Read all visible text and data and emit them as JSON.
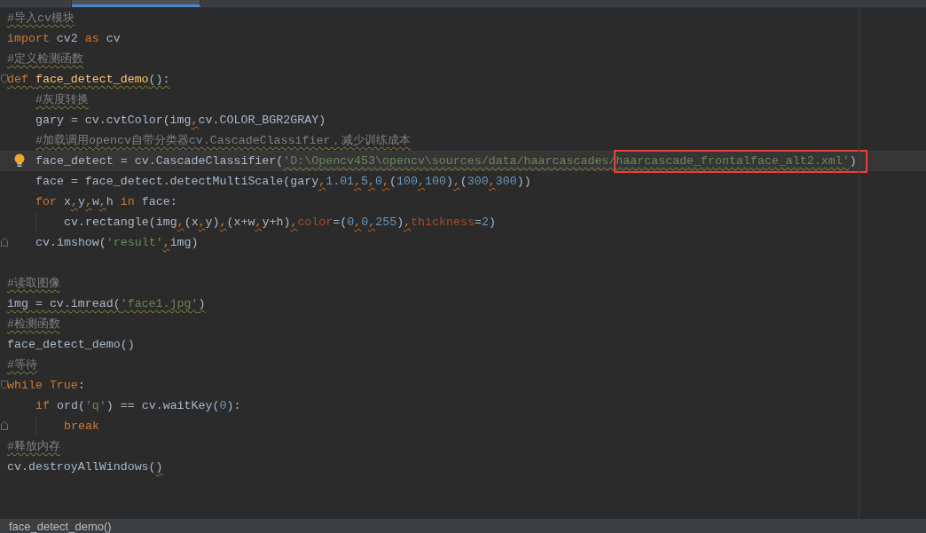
{
  "tabs": [
    {
      "selected": false
    },
    {
      "selected": true
    }
  ],
  "lines": [
    {
      "kind": "code",
      "current": false,
      "tokens": [
        {
          "kind": "comment",
          "text": "#导入cv模块",
          "squiggle": true
        }
      ]
    },
    {
      "kind": "code",
      "current": false,
      "tokens": [
        {
          "kind": "keyword",
          "text": "import",
          "squiggle": false
        },
        {
          "kind": "plain",
          "text": " cv2 ",
          "squiggle": false
        },
        {
          "kind": "keyword",
          "text": "as",
          "squiggle": false
        },
        {
          "kind": "plain",
          "text": " cv",
          "squiggle": false
        }
      ]
    },
    {
      "kind": "code",
      "current": false,
      "tokens": [
        {
          "kind": "comment",
          "text": "#定义检测函数",
          "squiggle": true
        }
      ]
    },
    {
      "kind": "code",
      "current": false,
      "fold": {
        "kind": "start"
      },
      "tokens": [
        {
          "kind": "keyword",
          "text": "def ",
          "squiggle": true
        },
        {
          "kind": "function",
          "text": "face_detect_demo",
          "squiggle": true
        },
        {
          "kind": "plain",
          "text": "():",
          "squiggle": true
        }
      ],
      "children": [
        {
          "kind": "code",
          "current": false,
          "tokens": [
            {
              "kind": "comment",
              "text": "#灰度转换",
              "squiggle": true
            }
          ]
        },
        {
          "kind": "code",
          "current": false,
          "tokens": [
            {
              "kind": "plain",
              "text": "gary = cv.cvtColor(img",
              "squiggle": false
            },
            {
              "kind": "comma",
              "text": ",",
              "squiggle": true
            },
            {
              "kind": "plain",
              "text": "cv.COLOR_BGR2GRAY)",
              "squiggle": false
            }
          ]
        },
        {
          "kind": "code",
          "current": false,
          "tokens": [
            {
              "kind": "comment",
              "text": "#加载调用opencv自带分类器cv.CascadeClassifier，减少训练成本",
              "squiggle": true
            }
          ]
        },
        {
          "kind": "code",
          "current": true,
          "marker": {
            "kind": "bulb"
          },
          "tokens": [
            {
              "kind": "plain",
              "text": "face_detect = cv.CascadeClassifier(",
              "squiggle": false
            },
            {
              "kind": "string",
              "text": "'D:\\Opencv453\\opencv\\sources/data/haarcascades/",
              "squiggle": true
            }
          ],
          "annotated_tokens": [
            {
              "kind": "string",
              "text": "haarcascade_frontalface_alt2.xml'",
              "squiggle": true
            },
            {
              "kind": "plain",
              "text": ")",
              "squiggle": false
            }
          ]
        },
        {
          "kind": "code",
          "current": false,
          "tokens": [
            {
              "kind": "plain",
              "text": "face = face_detect.detectMultiScale(gary",
              "squiggle": false
            },
            {
              "kind": "comma",
              "text": ",",
              "squiggle": true
            },
            {
              "kind": "number",
              "text": "1.01",
              "squiggle": false
            },
            {
              "kind": "comma",
              "text": ",",
              "squiggle": true
            },
            {
              "kind": "number",
              "text": "5",
              "squiggle": false
            },
            {
              "kind": "comma",
              "text": ",",
              "squiggle": true
            },
            {
              "kind": "number",
              "text": "0",
              "squiggle": false
            },
            {
              "kind": "comma",
              "text": ",",
              "squiggle": true
            },
            {
              "kind": "plain",
              "text": "(",
              "squiggle": false
            },
            {
              "kind": "number",
              "text": "100",
              "squiggle": false
            },
            {
              "kind": "comma",
              "text": ",",
              "squiggle": true
            },
            {
              "kind": "number",
              "text": "100",
              "squiggle": false
            },
            {
              "kind": "plain",
              "text": ")",
              "squiggle": false
            },
            {
              "kind": "comma",
              "text": ",",
              "squiggle": true
            },
            {
              "kind": "plain",
              "text": "(",
              "squiggle": false
            },
            {
              "kind": "number",
              "text": "300",
              "squiggle": false
            },
            {
              "kind": "comma",
              "text": ",",
              "squiggle": true
            },
            {
              "kind": "number",
              "text": "300",
              "squiggle": false
            },
            {
              "kind": "plain",
              "text": "))",
              "squiggle": false
            }
          ]
        },
        {
          "kind": "code",
          "current": false,
          "tokens": [
            {
              "kind": "keyword",
              "text": "for",
              "squiggle": false
            },
            {
              "kind": "plain",
              "text": " x",
              "squiggle": false
            },
            {
              "kind": "comma",
              "text": ",",
              "squiggle": true
            },
            {
              "kind": "plain",
              "text": "y",
              "squiggle": false
            },
            {
              "kind": "comma",
              "text": ",",
              "squiggle": true
            },
            {
              "kind": "plain",
              "text": "w",
              "squiggle": false
            },
            {
              "kind": "comma",
              "text": ",",
              "squiggle": true
            },
            {
              "kind": "plain",
              "text": "h ",
              "squiggle": false
            },
            {
              "kind": "keyword",
              "text": "in",
              "squiggle": false
            },
            {
              "kind": "plain",
              "text": " face:",
              "squiggle": false
            }
          ],
          "children": [
            {
              "kind": "code",
              "current": false,
              "tokens": [
                {
                  "kind": "plain",
                  "text": "cv.rectangle(img",
                  "squiggle": false
                },
                {
                  "kind": "comma",
                  "text": ",",
                  "squiggle": true
                },
                {
                  "kind": "plain",
                  "text": "(x",
                  "squiggle": false
                },
                {
                  "kind": "comma",
                  "text": ",",
                  "squiggle": true
                },
                {
                  "kind": "plain",
                  "text": "y)",
                  "squiggle": false
                },
                {
                  "kind": "comma",
                  "text": ",",
                  "squiggle": true
                },
                {
                  "kind": "plain",
                  "text": "(x+w",
                  "squiggle": false
                },
                {
                  "kind": "comma",
                  "text": ",",
                  "squiggle": true
                },
                {
                  "kind": "plain",
                  "text": "y+h)",
                  "squiggle": false
                },
                {
                  "kind": "comma",
                  "text": ",",
                  "squiggle": true
                },
                {
                  "kind": "kwarg",
                  "text": "color",
                  "squiggle": false
                },
                {
                  "kind": "plain",
                  "text": "=(",
                  "squiggle": false
                },
                {
                  "kind": "number",
                  "text": "0",
                  "squiggle": false
                },
                {
                  "kind": "comma",
                  "text": ",",
                  "squiggle": true
                },
                {
                  "kind": "number",
                  "text": "0",
                  "squiggle": false
                },
                {
                  "kind": "comma",
                  "text": ",",
                  "squiggle": true
                },
                {
                  "kind": "number",
                  "text": "255",
                  "squiggle": false
                },
                {
                  "kind": "plain",
                  "text": ")",
                  "squiggle": false
                },
                {
                  "kind": "comma",
                  "text": ",",
                  "squiggle": true
                },
                {
                  "kind": "kwarg",
                  "text": "thickness",
                  "squiggle": false
                },
                {
                  "kind": "plain",
                  "text": "=",
                  "squiggle": false
                },
                {
                  "kind": "number",
                  "text": "2",
                  "squiggle": false
                },
                {
                  "kind": "plain",
                  "text": ")",
                  "squiggle": false
                }
              ]
            }
          ]
        },
        {
          "kind": "code",
          "current": false,
          "fold": {
            "kind": "end"
          },
          "tokens": [
            {
              "kind": "plain",
              "text": "cv.imshow(",
              "squiggle": false
            },
            {
              "kind": "string",
              "text": "'result'",
              "squiggle": false
            },
            {
              "kind": "comma",
              "text": ",",
              "squiggle": true
            },
            {
              "kind": "plain",
              "text": "img)",
              "squiggle": false
            }
          ]
        }
      ]
    },
    {
      "kind": "blank",
      "current": false
    },
    {
      "kind": "code",
      "current": false,
      "tokens": [
        {
          "kind": "comment",
          "text": "#读取图像",
          "squiggle": true
        }
      ]
    },
    {
      "kind": "code",
      "current": false,
      "tokens": [
        {
          "kind": "plain",
          "text": "img = cv.imread(",
          "squiggle": true
        },
        {
          "kind": "string",
          "text": "'face1.jpg'",
          "squiggle": true
        },
        {
          "kind": "plain",
          "text": ")",
          "squiggle": true
        }
      ]
    },
    {
      "kind": "code",
      "current": false,
      "tokens": [
        {
          "kind": "comment",
          "text": "#检测函数",
          "squiggle": true
        }
      ]
    },
    {
      "kind": "code",
      "current": false,
      "tokens": [
        {
          "kind": "plain",
          "text": "face_detect_demo()",
          "squiggle": false
        }
      ]
    },
    {
      "kind": "code",
      "current": false,
      "tokens": [
        {
          "kind": "comment",
          "text": "#等待",
          "squiggle": true
        }
      ]
    },
    {
      "kind": "code",
      "current": false,
      "fold": {
        "kind": "start"
      },
      "tokens": [
        {
          "kind": "keyword",
          "text": "while ",
          "squiggle": false
        },
        {
          "kind": "keyword",
          "text": "True",
          "squiggle": false
        },
        {
          "kind": "plain",
          "text": ":",
          "squiggle": false
        }
      ],
      "children": [
        {
          "kind": "code",
          "current": false,
          "tokens": [
            {
              "kind": "keyword",
              "text": "if",
              "squiggle": false
            },
            {
              "kind": "plain",
              "text": " ord(",
              "squiggle": false
            },
            {
              "kind": "string",
              "text": "'q'",
              "squiggle": false
            },
            {
              "kind": "plain",
              "text": ") == cv.waitKey(",
              "squiggle": false
            },
            {
              "kind": "number",
              "text": "0",
              "squiggle": false
            },
            {
              "kind": "plain",
              "text": "):",
              "squiggle": false
            }
          ],
          "children": [
            {
              "kind": "code",
              "current": false,
              "fold": {
                "kind": "end"
              },
              "tokens": [
                {
                  "kind": "keyword",
                  "text": "break",
                  "squiggle": false
                }
              ]
            }
          ]
        }
      ]
    },
    {
      "kind": "code",
      "current": false,
      "tokens": [
        {
          "kind": "comment",
          "text": "#释放内存",
          "squiggle": true
        }
      ]
    },
    {
      "kind": "code",
      "current": false,
      "tokens": [
        {
          "kind": "plain",
          "text": "cv.destroyAllWindows(",
          "squiggle": false
        },
        {
          "kind": "plain",
          "text": ")",
          "squiggle": true
        }
      ]
    }
  ],
  "status_bar": {
    "breadcrumb": "face_detect_demo()"
  }
}
